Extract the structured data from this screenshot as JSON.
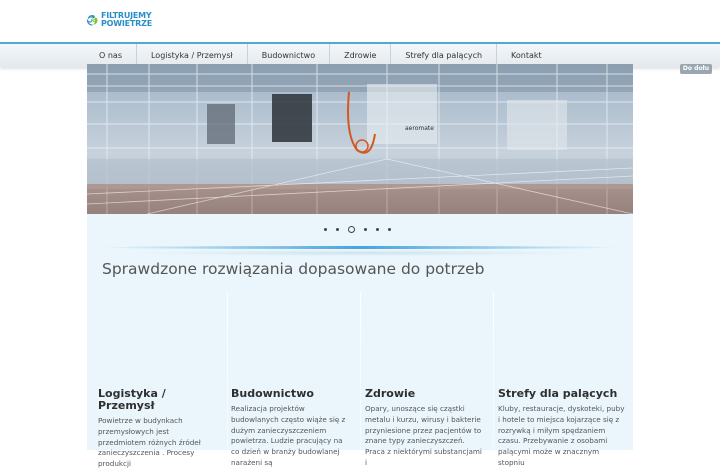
{
  "logo": {
    "line1": "FILTRUJEMY",
    "line2": "POWIETRZE"
  },
  "nav": {
    "items": [
      {
        "label": "O nas"
      },
      {
        "label": "Logistyka / Przemysł"
      },
      {
        "label": "Budownictwo"
      },
      {
        "label": "Zdrowie"
      },
      {
        "label": "Strefy dla palących"
      },
      {
        "label": "Kontakt"
      }
    ]
  },
  "back_to_top": "Do dołu",
  "slider": {
    "dots": 6,
    "active_index": 2,
    "banner_text": "aeromate"
  },
  "headline": "Sprawdzone rozwiązania dopasowane do potrzeb",
  "columns": [
    {
      "title": "Logistyka / Przemysł",
      "text": "Powietrze w budynkach przemysłowych jest przedmiotem różnych źródeł zanieczyszczenia . Procesy produkcji"
    },
    {
      "title": "Budownictwo",
      "text": "Realizacja projektów budowlanych często wiąże się z dużym zanieczyszczeniem powietrza. Ludzie pracujący na co dzień w branży budowlanej narażeni są"
    },
    {
      "title": "Zdrowie",
      "text": "Opary, unoszące się cząstki metalu i kurzu, wirusy i bakterie przyniesione przez pacjentów to znane typy zanieczyszczeń. Praca z niektórymi substancjami i"
    },
    {
      "title": "Strefy dla palących",
      "text": "Kluby, restauracje, dyskoteki, puby i hotele to miejsca kojarzące się z rozrywką i  miłym spędzaniem czasu. Przebywanie z osobami palącymi może w znacznym stopniu"
    }
  ],
  "colors": {
    "accent": "#4aa3dc",
    "content_bg": "#eaf6fc"
  }
}
